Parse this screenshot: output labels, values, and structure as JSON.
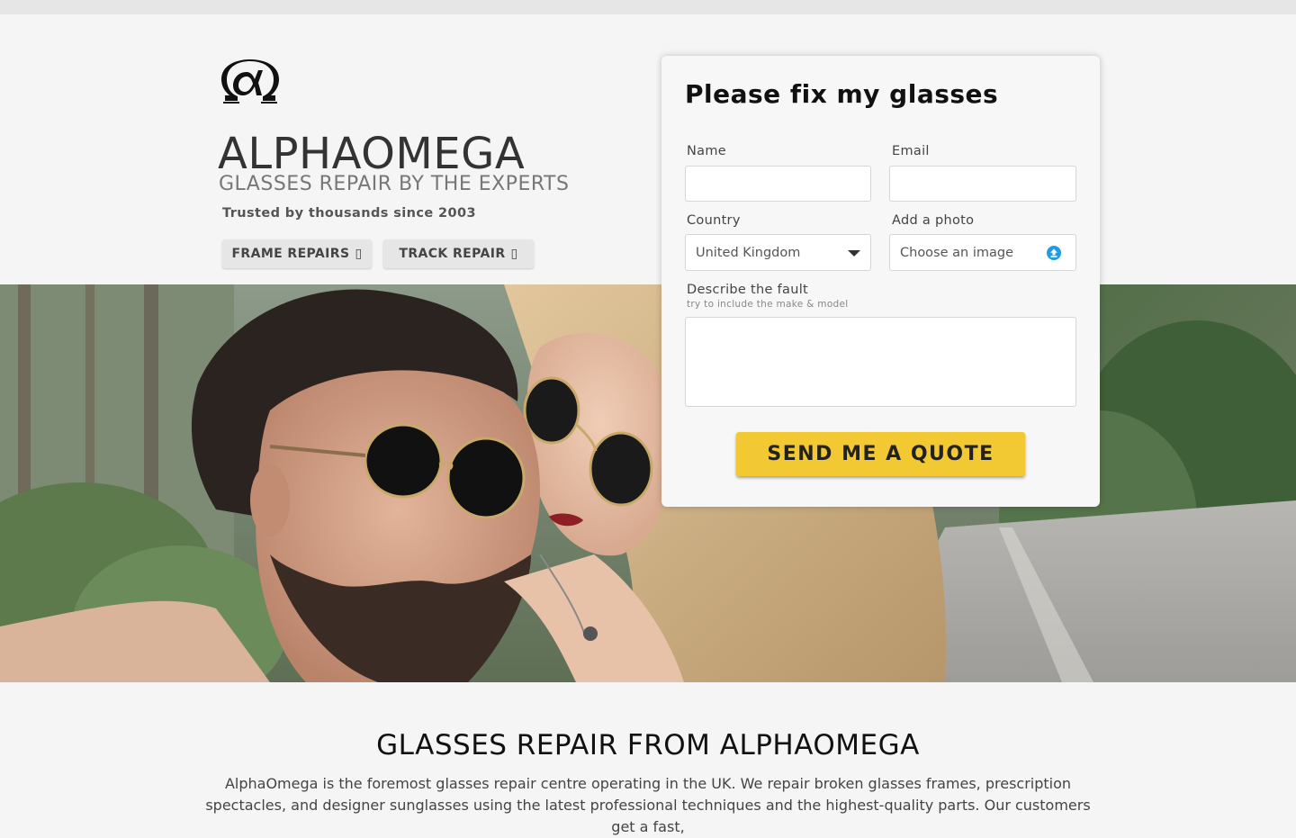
{
  "header": {
    "brand": "ALPHAOMEGA",
    "tagline": "GLASSES REPAIR BY THE EXPERTS",
    "trusted": "Trusted by thousands since 2003",
    "buttons": [
      {
        "label": "FRAME REPAIRS",
        "glyph": "▯"
      },
      {
        "label": "TRACK REPAIR",
        "glyph": "▯"
      }
    ]
  },
  "form": {
    "title": "Please fix my glasses",
    "name_label": "Name",
    "email_label": "Email",
    "country_label": "Country",
    "country_value": "United Kingdom",
    "photo_label": "Add a photo",
    "photo_placeholder": "Choose an image",
    "fault_label": "Describe the fault",
    "fault_hint": "try to include the make & model",
    "submit_label": "SEND ME A QUOTE"
  },
  "about": {
    "heading": "GLASSES REPAIR FROM ALPHAOMEGA",
    "text": "AlphaOmega is the foremost glasses repair centre operating in the UK. We repair broken glasses frames, prescription spectacles, and designer sunglasses using the latest professional techniques and the highest-quality parts. Our customers get a fast,"
  },
  "colors": {
    "accent_button": "#f2c933",
    "upload_icon": "#1e9be9"
  },
  "icons": {
    "logo": "alpha-omega-logo",
    "select_caret": "caret-down-icon",
    "upload": "upload-icon"
  }
}
